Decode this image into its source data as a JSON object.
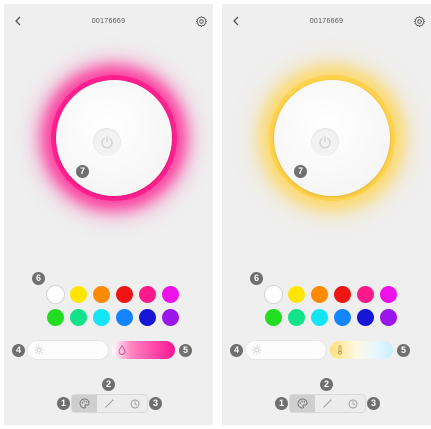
{
  "screens": [
    {
      "title": "00176669",
      "glow_color": "#ff1f8e",
      "glow_halo": "rgba(255,20,140,0.55)",
      "temp_slider_gradient": "linear-gradient(90deg, #ffffff 0%, #ff85c0 30%, #ff1493 100%)",
      "temp_slider_icon": "droplet-icon"
    },
    {
      "title": "00176669",
      "glow_color": "#ffd24a",
      "glow_halo": "rgba(255,212,80,0.55)",
      "temp_slider_gradient": "linear-gradient(90deg, #ffe07a 0%, #fff8e0 40%, #e6f6ff 75%, #c8eeff 100%)",
      "temp_slider_icon": "thermometer-icon"
    }
  ],
  "badges": {
    "mode_color": "1",
    "mode_scene": "2",
    "mode_timer": "3",
    "brightness": "4",
    "temperature": "5",
    "palette": "6",
    "power": "7"
  },
  "palette": {
    "row1": [
      "#ffffff",
      "#ffe600",
      "#ff8a00",
      "#f01515",
      "#ff1a8c",
      "#ee12e8"
    ],
    "row2": [
      "#22dd22",
      "#12e38a",
      "#12e5f4",
      "#1585ff",
      "#1616d6",
      "#9a16ea"
    ]
  },
  "icons": {
    "back": "chevron-left-icon",
    "settings": "gear-icon",
    "power": "power-icon",
    "brightness": "sun-icon",
    "mode_color": "palette-icon",
    "mode_scene": "magic-wand-icon",
    "mode_timer": "clock-icon"
  }
}
